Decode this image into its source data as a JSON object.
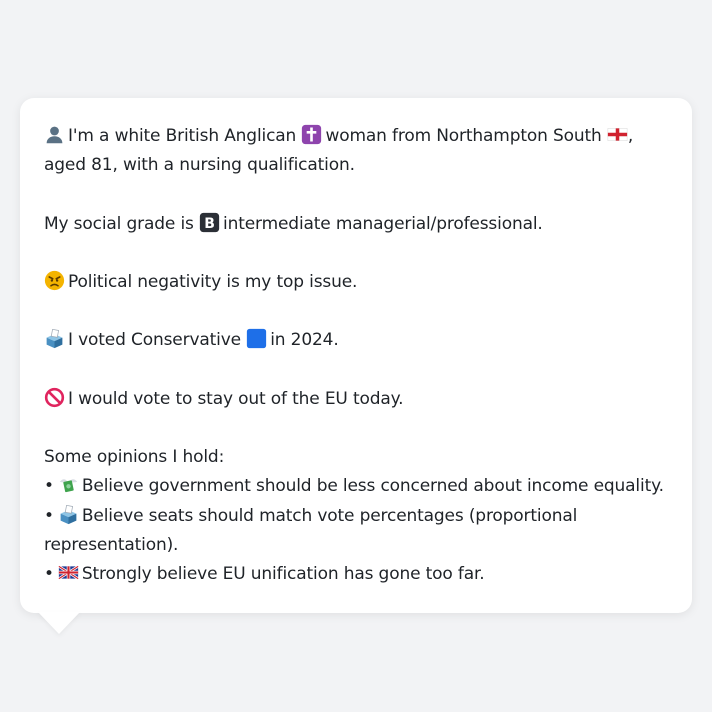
{
  "bio": {
    "icon_person": "person-silhouette-icon",
    "p1_a": "I'm a white British Anglican",
    "icon_cross": "latin-cross-icon",
    "p1_b": "woman from Northampton South",
    "icon_flag": "england-flag-icon",
    "p1_c": ", aged 81, with a nursing qualification."
  },
  "grade": {
    "prefix": "My social grade is",
    "icon_b": "b-button-icon",
    "suffix": "intermediate managerial/professional."
  },
  "issue": {
    "icon": "angry-face-icon",
    "text": "Political negativity is my top issue."
  },
  "vote": {
    "icon": "ballot-box-icon",
    "prefix": "I voted Conservative",
    "icon_square": "blue-square-icon",
    "suffix": "in 2024."
  },
  "eu": {
    "icon": "prohibited-icon",
    "text": "I would vote to stay out of the EU today."
  },
  "opinions": {
    "heading": "Some opinions I hold:",
    "items": [
      {
        "bullet": "•",
        "icon": "money-with-wings-icon",
        "text": "Believe government should be less concerned about income equality."
      },
      {
        "bullet": "•",
        "icon": "ballot-box-icon",
        "text": "Believe seats should match vote percentages (proportional representation)."
      },
      {
        "bullet": "•",
        "icon": "uk-flag-icon",
        "text": "Strongly believe EU unification has gone too far."
      }
    ]
  },
  "colors": {
    "background": "#f2f3f5",
    "bubble": "#ffffff",
    "text": "#1f2328",
    "party_blue": "#1e6fe8"
  }
}
